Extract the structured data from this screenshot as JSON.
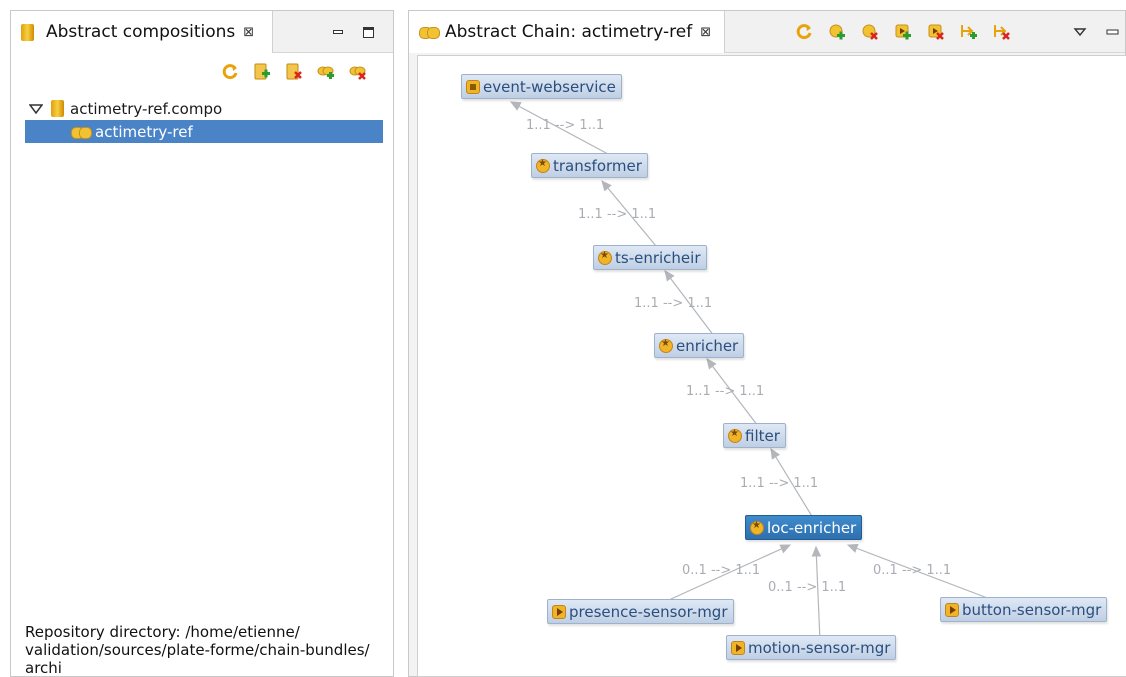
{
  "left_view": {
    "title": "Abstract compositions",
    "close_glyph": "⊠",
    "toolbar_icons": [
      "refresh-icon",
      "new-composition-icon",
      "delete-composition-icon",
      "add-chain-icon",
      "remove-chain-icon"
    ],
    "tree": [
      {
        "label": "actimetry-ref.compo",
        "icon": "jar-icon",
        "expanded": true,
        "level": 0
      },
      {
        "label": "actimetry-ref",
        "icon": "chain-icon",
        "selected": true,
        "level": 1
      }
    ],
    "repository": {
      "line1": "Repository directory: /home/etienne/",
      "line2": "validation/sources/plate-forme/chain-bundles/",
      "line3": "archi"
    }
  },
  "right_view": {
    "title": "Abstract Chain: actimetry-ref",
    "close_glyph": "⊠",
    "toolbar_icons": [
      "refresh-icon",
      "add-node-icon",
      "remove-node-icon",
      "add-input-icon",
      "remove-input-icon",
      "add-link-icon",
      "remove-link-icon"
    ],
    "graph": {
      "nodes": {
        "event_webservice": "event-webservice",
        "transformer": "transformer",
        "ts_enricheir": "ts-enricheir",
        "enricher": "enricher",
        "filter": "filter",
        "loc_enricher": "loc-enricher",
        "presence": "presence-sensor-mgr",
        "motion": "motion-sensor-mgr",
        "button": "button-sensor-mgr"
      },
      "edge_labels": {
        "e1": "1..1 --> 1..1",
        "e2": "1..1 --> 1..1",
        "e3": "1..1 --> 1..1",
        "e4": "1..1 --> 1..1",
        "e5": "1..1 --> 1..1",
        "e6": "0..1 --> 1..1",
        "e7": "0..1 --> 1..1",
        "e8": "0..1 --> 1..1"
      }
    }
  },
  "colors": {
    "selection": "#4a84c7",
    "node_text": "#2a4f7d",
    "edge": "#b3b6ba",
    "edge_label": "#a9adb3"
  }
}
